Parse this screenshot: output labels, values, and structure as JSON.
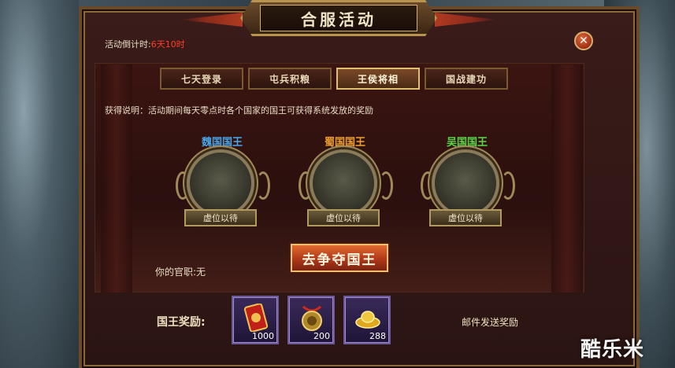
{
  "window": {
    "title": "合服活动"
  },
  "countdown": {
    "label": "活动倒计时:",
    "value": "6天10时",
    "value_color": "#ff3c28"
  },
  "tabs": [
    {
      "label": "七天登录",
      "active": false
    },
    {
      "label": "屯兵积粮",
      "active": false
    },
    {
      "label": "王侯将相",
      "active": true
    },
    {
      "label": "国战建功",
      "active": false
    }
  ],
  "description": "获得说明：活动期间每天零点时各个国家的国王可获得系统发放的奖励",
  "kings": [
    {
      "name": "魏国国王",
      "color": "#4aa6e8",
      "status": "虚位以待"
    },
    {
      "name": "蜀国国王",
      "color": "#f0a030",
      "status": "虚位以待"
    },
    {
      "name": "吴国国王",
      "color": "#5ad84a",
      "status": "虚位以待"
    }
  ],
  "contest_button": "去争夺国王",
  "official_rank": "你的官职:无",
  "rewards": {
    "label": "国王奖励:",
    "items": [
      {
        "icon": "scroll-token-icon",
        "qty": "1000"
      },
      {
        "icon": "coin-medal-icon",
        "qty": "200"
      },
      {
        "icon": "gold-ingot-icon",
        "qty": "288"
      }
    ],
    "delivery": "邮件发送奖励"
  },
  "watermark": "酷乐米"
}
